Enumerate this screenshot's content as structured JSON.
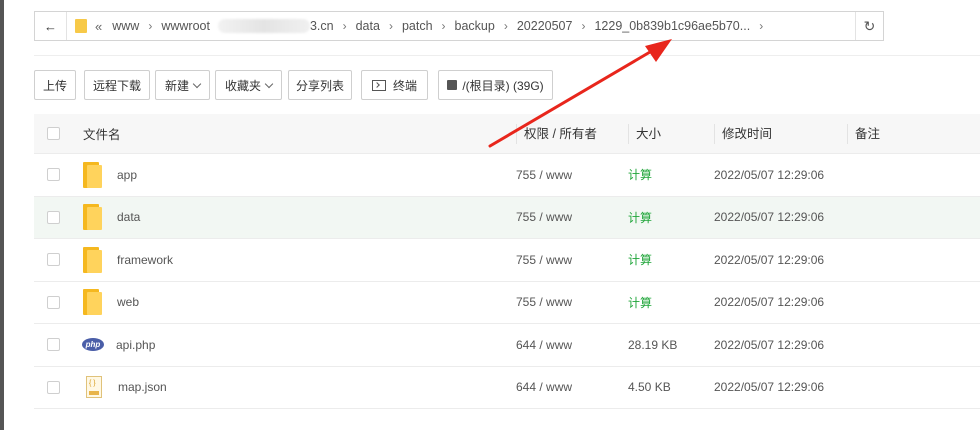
{
  "pathbar": {
    "back_icon": "arrow-left-icon",
    "double_chevron": "«",
    "crumbs": [
      "www",
      "wwwroot",
      "3.cn",
      "data",
      "patch",
      "backup",
      "20220507",
      "1229_0b839b1c96ae5b70..."
    ],
    "separator": "›",
    "refresh_icon": "refresh-icon"
  },
  "toolbar": {
    "upload": "上传",
    "remote_download": "远程下载",
    "new": "新建",
    "favorites": "收藏夹",
    "share_list": "分享列表",
    "terminal": "终端",
    "disk": "/(根目录) (39G)"
  },
  "table": {
    "headers": {
      "name": "文件名",
      "perm": "权限 / 所有者",
      "size": "大小",
      "mtime": "修改时间",
      "note": "备注"
    },
    "rows": [
      {
        "name": "app",
        "type": "folder",
        "perm": "755 / www",
        "size": "计算",
        "mtime": "2022/05/07 12:29:06"
      },
      {
        "name": "data",
        "type": "folder",
        "perm": "755 / www",
        "size": "计算",
        "mtime": "2022/05/07 12:29:06"
      },
      {
        "name": "framework",
        "type": "folder",
        "perm": "755 / www",
        "size": "计算",
        "mtime": "2022/05/07 12:29:06"
      },
      {
        "name": "web",
        "type": "folder",
        "perm": "755 / www",
        "size": "计算",
        "mtime": "2022/05/07 12:29:06"
      },
      {
        "name": "api.php",
        "type": "php",
        "perm": "644 / www",
        "size": "28.19 KB",
        "mtime": "2022/05/07 12:29:06"
      },
      {
        "name": "map.json",
        "type": "json",
        "perm": "644 / www",
        "size": "4.50 KB",
        "mtime": "2022/05/07 12:29:06"
      }
    ]
  },
  "php_badge": "php",
  "colors": {
    "calc_link": "#20a53a",
    "folder": "#f5b81f",
    "annotation_arrow": "#e8261c",
    "row_highlight": "#f2f7f3"
  }
}
